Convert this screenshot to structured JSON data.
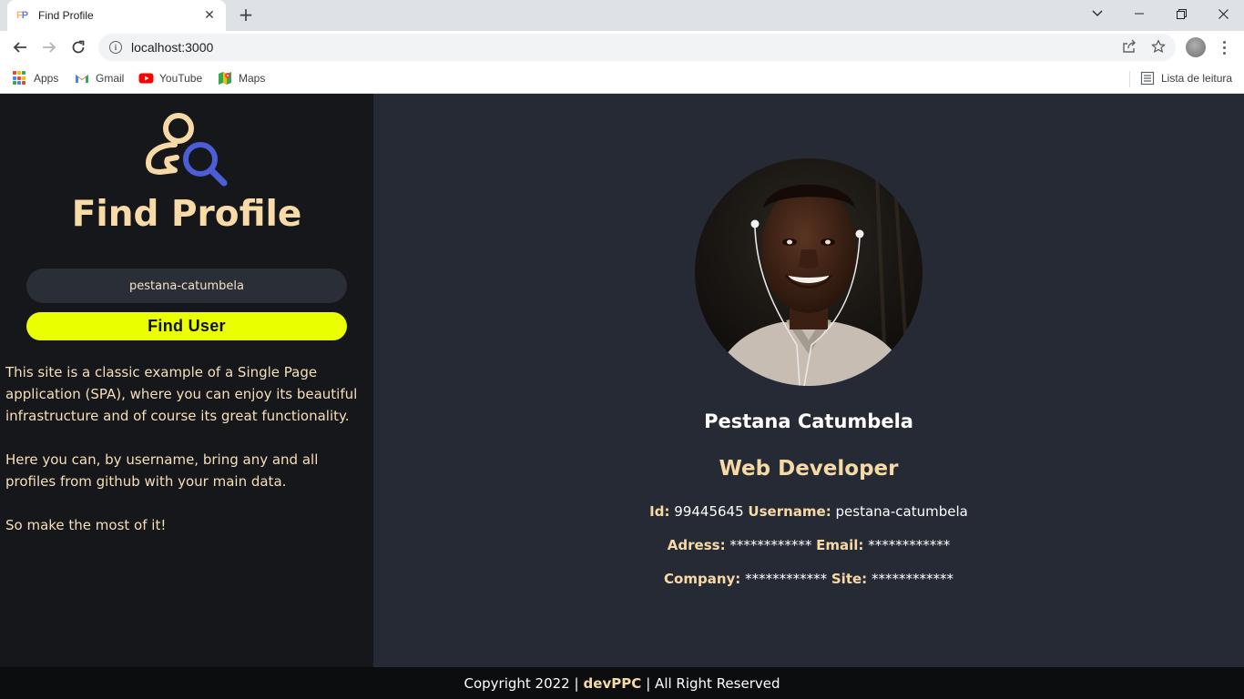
{
  "browser": {
    "tab": {
      "favicon_text_a": "F",
      "favicon_text_b": "P",
      "title": "Find Profile"
    },
    "address_bar": {
      "url": "localhost:3000"
    },
    "bookmarks": [
      {
        "label": "Apps",
        "icon": "apps-grid-icon"
      },
      {
        "label": "Gmail",
        "icon": "gmail-icon"
      },
      {
        "label": "YouTube",
        "icon": "youtube-icon"
      },
      {
        "label": "Maps",
        "icon": "maps-icon"
      }
    ],
    "reading_list": {
      "label": "Lista de leitura",
      "icon": "reading-list-icon"
    }
  },
  "sidebar": {
    "title": "Find Profile",
    "search": {
      "value": "pestana-catumbela",
      "placeholder": ""
    },
    "find_button": "Find User",
    "description": [
      "This site is a classic example of a Single Page application (SPA), where you can enjoy its beautiful infrastructure and of course its great functionality.",
      "Here you can, by username, bring any and all profiles from github with your main data.",
      "So make the most of it!"
    ]
  },
  "profile": {
    "name": "Pestana Catumbela",
    "role": "Web Developer",
    "fields": {
      "id_label": "Id:",
      "id_value": "99445645",
      "username_label": "Username:",
      "username_value": "pestana-catumbela",
      "address_label": "Adress:",
      "address_value": "************",
      "email_label": "Email:",
      "email_value": "************",
      "company_label": "Company:",
      "company_value": "************",
      "site_label": "Site:",
      "site_value": "************"
    }
  },
  "footer": {
    "prefix": "Copyright 2022 |",
    "brand": "devPPC",
    "suffix": "| All Right Reserved"
  },
  "colors": {
    "sidebar_bg": "#16171b",
    "main_bg": "#252a34",
    "accent_cream": "#f7d9a5",
    "button_yellow": "#eaff00",
    "logo_blue": "#4b5ed6",
    "footer_bg": "#0c0d0e"
  }
}
